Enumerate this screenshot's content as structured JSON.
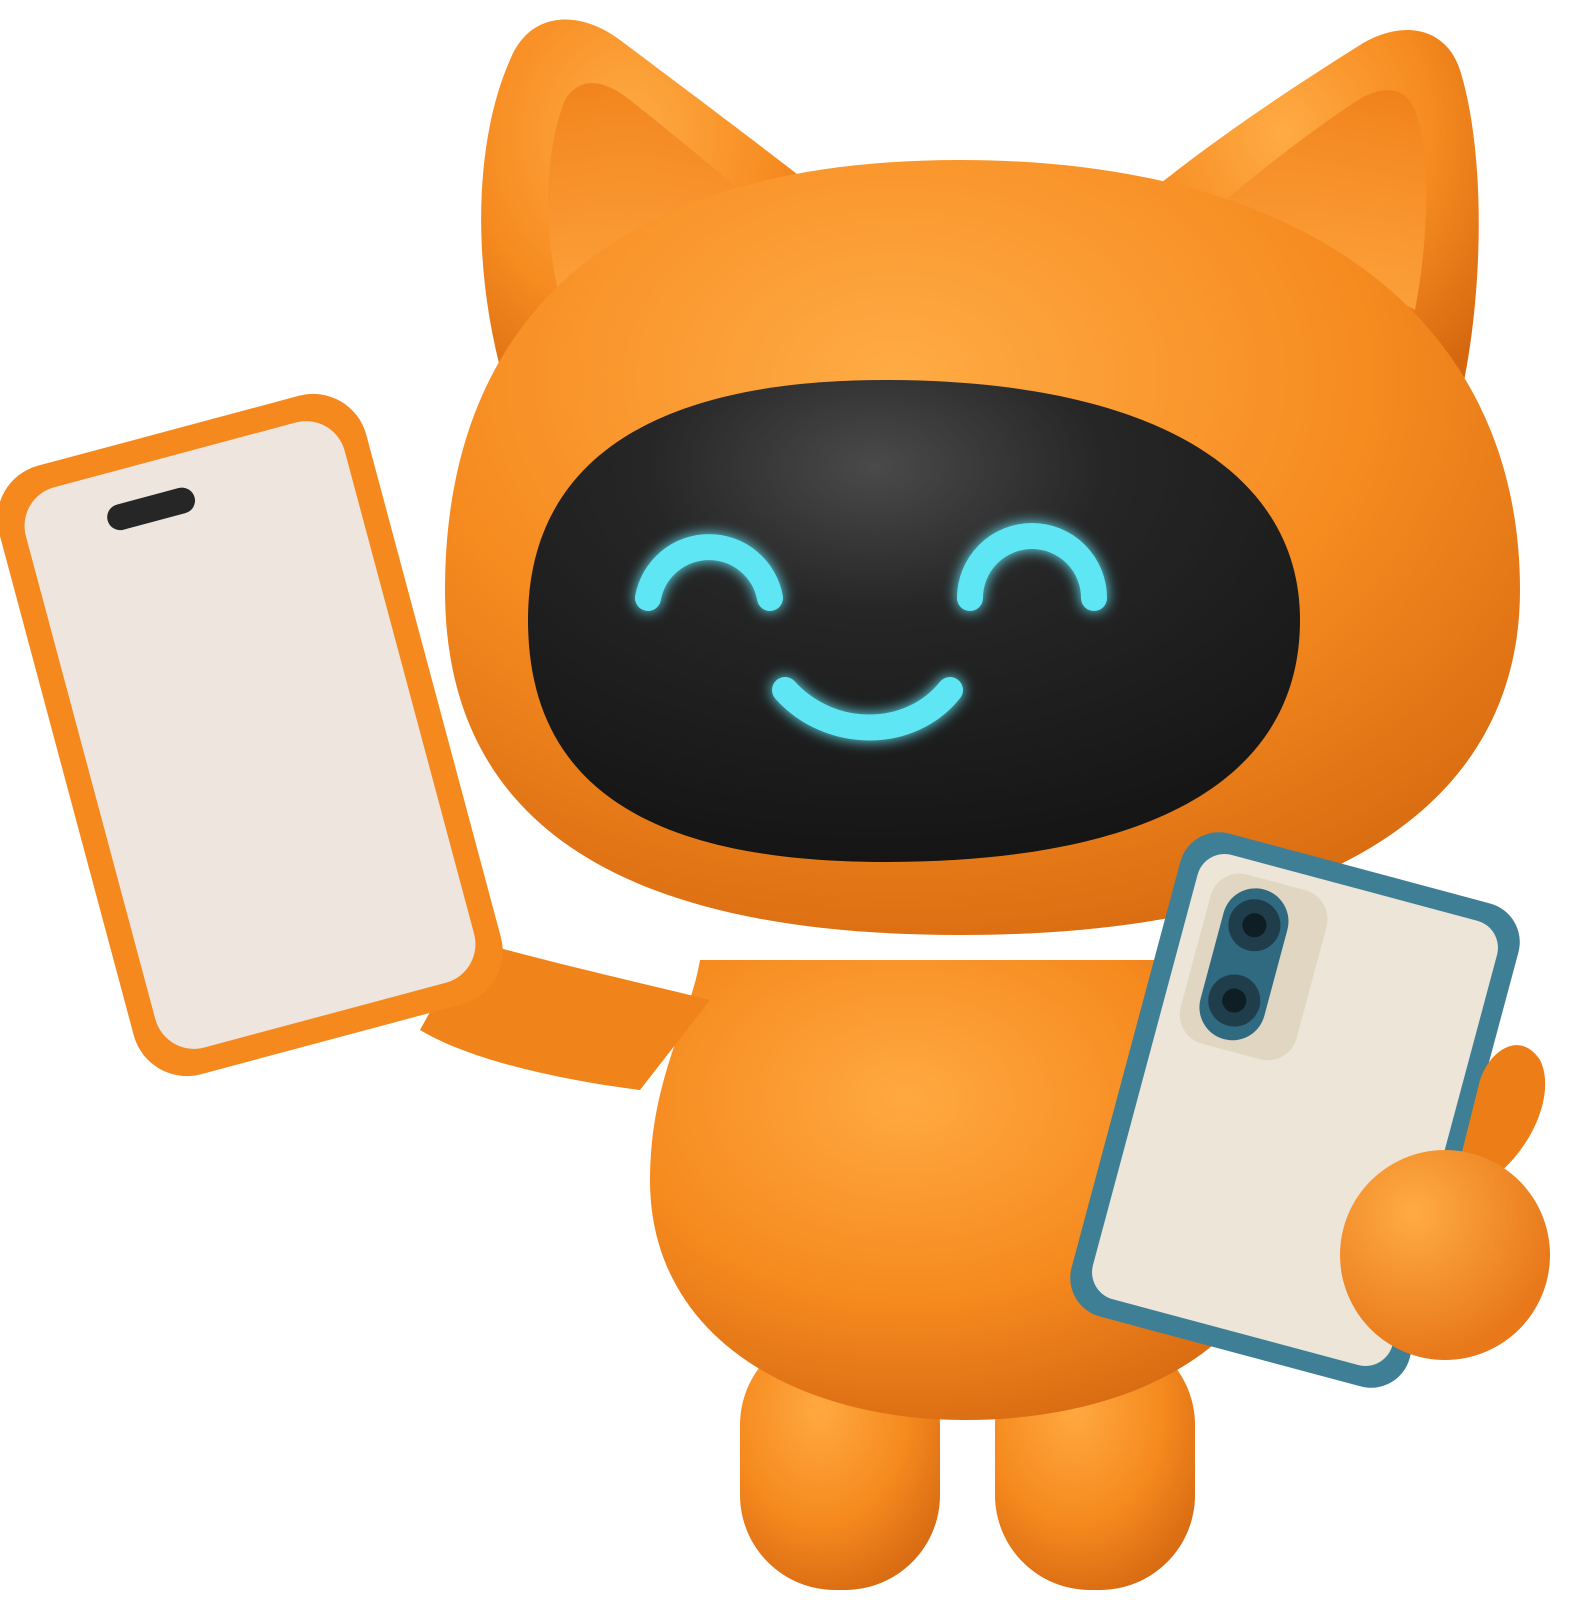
{
  "illustration": {
    "subject": "orange-cat-robot-mascot",
    "expression": "smiling",
    "props": [
      "phone-front-screen",
      "phone-back-camera"
    ]
  },
  "colors": {
    "background": "#ffffff",
    "body_orange": "#f5891e",
    "body_orange_light": "#ffa33a",
    "body_orange_dark": "#d96a12",
    "visor_black": "#1e1e1e",
    "face_glow_cyan": "#5fe6f5",
    "phone_screen_cream": "#eee6de",
    "phone_back_cream": "#ece5d8",
    "phone_case_teal": "#3e7f96",
    "camera_dark": "#1f3d4a"
  }
}
